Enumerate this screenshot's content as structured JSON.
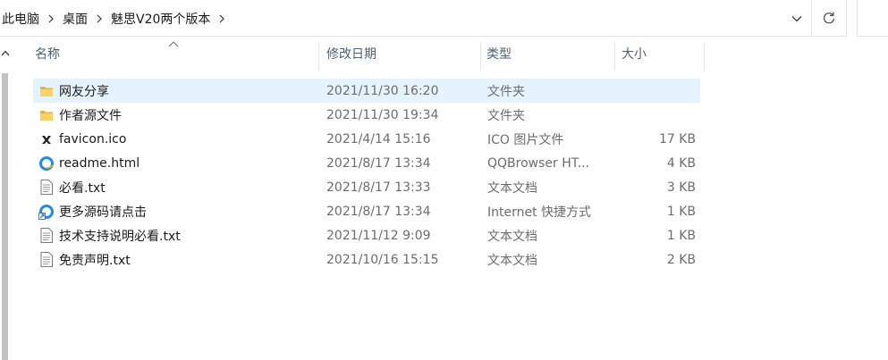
{
  "address_bar": {
    "crumbs": [
      "此电脑",
      "桌面",
      "魅思V20两个版本"
    ]
  },
  "columns": {
    "name": "名称",
    "date": "修改日期",
    "type": "类型",
    "size": "大小"
  },
  "files": [
    {
      "name": "网友分享",
      "date": "2021/11/30 16:20",
      "type": "文件夹",
      "size": "",
      "icon": "folder-icon",
      "selected": true
    },
    {
      "name": "作者源文件",
      "date": "2021/11/30 19:34",
      "type": "文件夹",
      "size": "",
      "icon": "folder-icon",
      "selected": false
    },
    {
      "name": "favicon.ico",
      "date": "2021/4/14 15:16",
      "type": "ICO 图片文件",
      "size": "17 KB",
      "icon": "ico-file-icon",
      "selected": false
    },
    {
      "name": "readme.html",
      "date": "2021/8/17 13:34",
      "type": "QQBrowser HT...",
      "size": "4 KB",
      "icon": "qqbrowser-html-icon",
      "selected": false
    },
    {
      "name": "必看.txt",
      "date": "2021/8/17 13:33",
      "type": "文本文档",
      "size": "3 KB",
      "icon": "text-file-icon",
      "selected": false
    },
    {
      "name": "更多源码请点击",
      "date": "2021/8/17 13:34",
      "type": "Internet 快捷方式",
      "size": "1 KB",
      "icon": "internet-shortcut-icon",
      "selected": false
    },
    {
      "name": "技术支持说明必看.txt",
      "date": "2021/11/12 9:09",
      "type": "文本文档",
      "size": "1 KB",
      "icon": "text-file-icon",
      "selected": false
    },
    {
      "name": "免责声明.txt",
      "date": "2021/10/16 15:15",
      "type": "文本文档",
      "size": "2 KB",
      "icon": "text-file-icon",
      "selected": false
    }
  ]
}
